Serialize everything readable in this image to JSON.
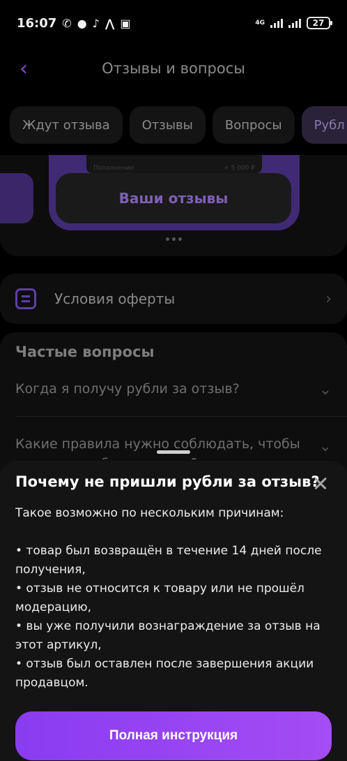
{
  "status_bar": {
    "time": "16:07",
    "network": "4G",
    "battery": "27"
  },
  "header": {
    "back_icon": "chevron-left-icon",
    "title": "Отзывы и вопросы"
  },
  "tabs": [
    {
      "label": "Ждут отзыва"
    },
    {
      "label": "Отзывы"
    },
    {
      "label": "Вопросы"
    },
    {
      "label": "Рубл"
    }
  ],
  "banner": {
    "strip_left": "Пополнение",
    "strip_right": "+ 5 000 ₽",
    "button_label": "Ваши отзывы"
  },
  "offer": {
    "icon": "document-icon",
    "label": "Условия оферты"
  },
  "faq": {
    "title": "Частые вопросы",
    "questions": [
      {
        "text": "Когда я получу рубли за отзыв?"
      },
      {
        "text": "Какие правила нужно соблюдать, чтобы получить рубли за отзыв?"
      }
    ]
  },
  "sheet": {
    "title": "Почему не пришли рубли за отзыв?",
    "intro": "Такое возможно по нескольким причинам:",
    "reasons": [
      "• товар был возвращён в течение 14 дней после получения,",
      "• отзыв не относится к товару или не прошёл модерацию,",
      "• вы уже получили вознаграждение за отзыв на этот артикул,",
      "• отзыв был оставлен после завершения акции продавцом."
    ],
    "cta_label": "Полная инструкция"
  },
  "colors": {
    "accent": "#9a45f3",
    "tab_active_bg": "#2a2238",
    "sheet_bg": "#141414"
  }
}
